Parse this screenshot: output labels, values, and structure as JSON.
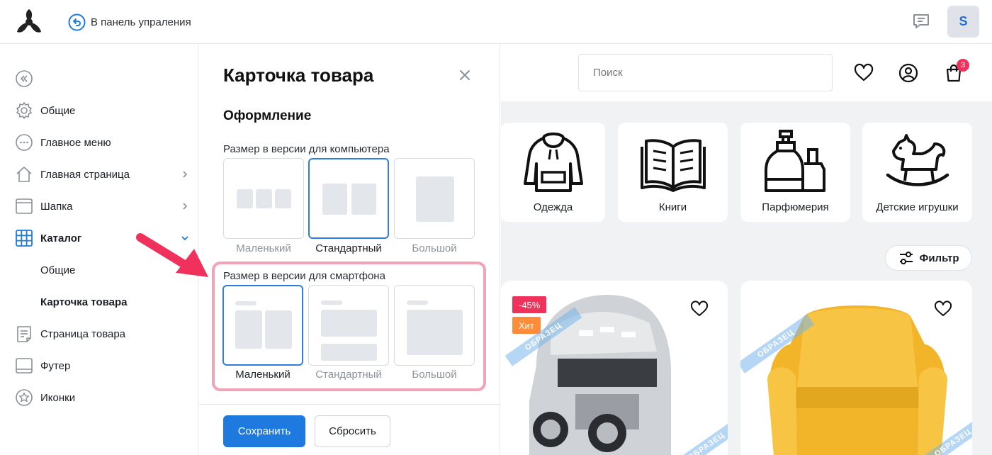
{
  "topbar": {
    "back_label": "В панель упраления",
    "user_initial": "S"
  },
  "sidebar": {
    "items": [
      {
        "label": "Общие"
      },
      {
        "label": "Главное меню"
      },
      {
        "label": "Главная страница"
      },
      {
        "label": "Шапка"
      },
      {
        "label": "Каталог"
      },
      {
        "label": "Общие"
      },
      {
        "label": "Карточка товара"
      },
      {
        "label": "Страница товара"
      },
      {
        "label": "Футер"
      },
      {
        "label": "Иконки"
      }
    ]
  },
  "panel": {
    "title": "Карточка товара",
    "section": "Оформление",
    "desktop": {
      "label": "Размер в версии для компьютера",
      "options": [
        "Маленький",
        "Стандартный",
        "Большой"
      ],
      "selected": "Стандартный"
    },
    "mobile": {
      "label": "Размер в версии для смартфона",
      "options": [
        "Маленький",
        "Стандартный",
        "Большой"
      ],
      "selected": "Маленький"
    },
    "save_label": "Сохранить",
    "reset_label": "Сбросить"
  },
  "preview": {
    "search_placeholder": "Поиск",
    "cart_count": "3",
    "categories": [
      "Одежда",
      "Книги",
      "Парфюмерия",
      "Детские игрушки"
    ],
    "filter_label": "Фильтр",
    "product1": {
      "badges": [
        "-45%",
        "Хит"
      ]
    },
    "watermark": "ОБРАЗЕЦ"
  },
  "colors": {
    "accent": "#1f7ae0",
    "highlight": "#f1a4b6",
    "arrow": "#f0315c",
    "sale_badge": "#f0315c",
    "hit_badge": "#ff8c3a"
  }
}
